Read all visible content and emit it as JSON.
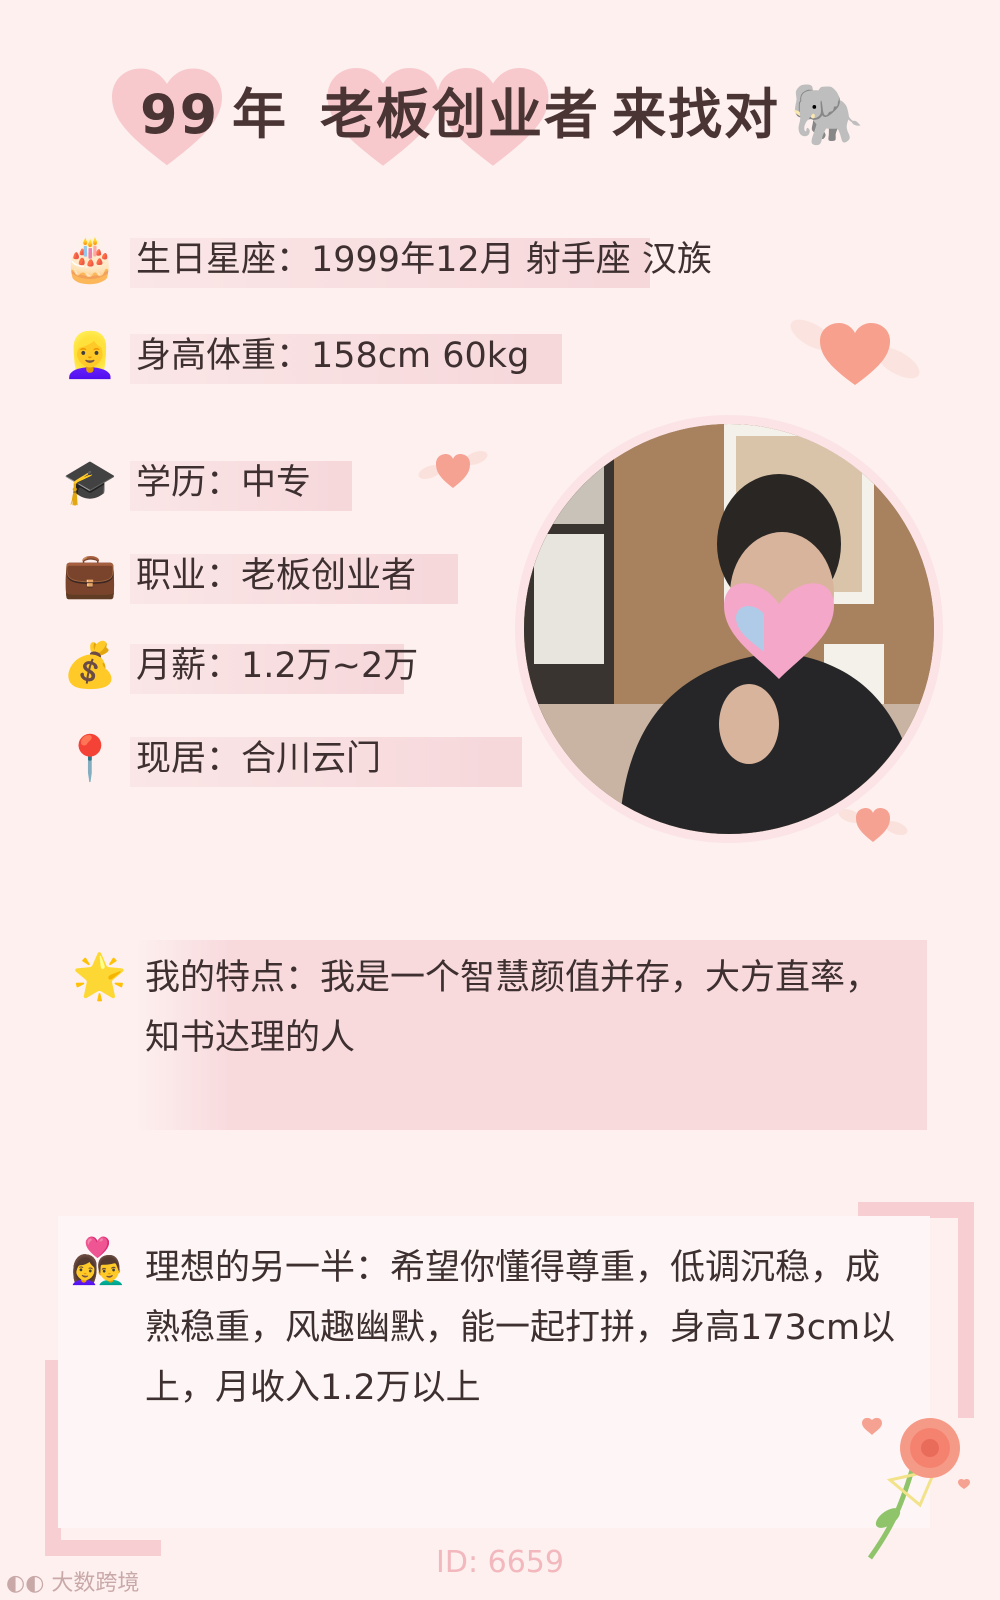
{
  "title": {
    "part1": "99",
    "part2": "年",
    "part3": "老板创业者",
    "part4": "来找对",
    "emoji": "🐘"
  },
  "info": [
    {
      "icon": "🎂",
      "text": "生日星座：1999年12月 射手座 汉族"
    },
    {
      "icon": "👱‍♀️",
      "text": "身高体重：158cm 60kg"
    },
    {
      "icon": "🎓",
      "text": "学历：中专"
    },
    {
      "icon": "💼",
      "text": "职业：老板创业者"
    },
    {
      "icon": "💰",
      "text": "月薪：1.2万~2万"
    },
    {
      "icon": "📍",
      "text": "现居：合川云门"
    }
  ],
  "feature": {
    "icon": "🌟",
    "text": "我的特点：我是一个智慧颜值并存，大方直率，知书达理的人"
  },
  "ideal": {
    "icon": "👩‍❤️‍👨",
    "text": "理想的另一半：希望你懂得尊重，低调沉稳，成熟稳重，风趣幽默，能一起打拼，身高173cm以上，月收入1.2万以上"
  },
  "footer": {
    "id_text": "ID: 6659"
  },
  "watermark": {
    "text": "大数跨境"
  },
  "colors": {
    "accent": "#f6d7da",
    "heart": "#f7a79a",
    "text": "#3e3030"
  }
}
